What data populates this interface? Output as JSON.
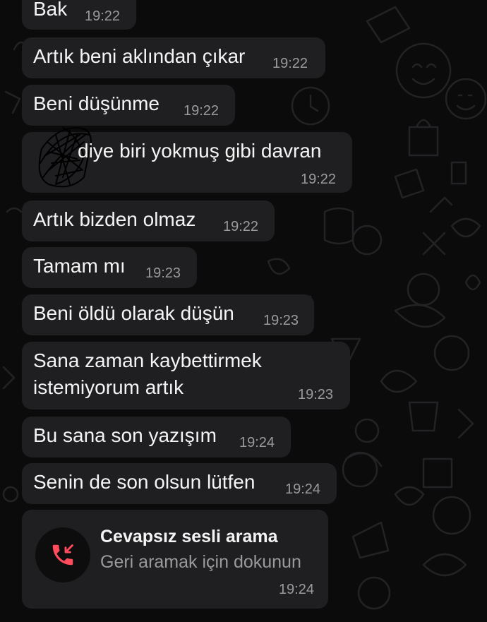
{
  "messages": [
    {
      "text": "Bak",
      "time": "19:22"
    },
    {
      "text": "Artık beni aklından çıkar",
      "time": "19:22"
    },
    {
      "text": "Beni düşünme",
      "time": "19:22"
    },
    {
      "text": "diye biri yokmuş gibi davran",
      "time": "19:22"
    },
    {
      "text": "Artık bizden olmaz",
      "time": "19:22"
    },
    {
      "text": "Tamam mı",
      "time": "19:23"
    },
    {
      "text": "Beni öldü olarak düşün",
      "time": "19:23"
    },
    {
      "text": "Sana zaman kaybettirmek",
      "text2": "istemiyorum artık",
      "time": "19:23"
    },
    {
      "text": "Bu sana son yazışım",
      "time": "19:24"
    },
    {
      "text": "Senin de son olsun lütfen",
      "time": "19:24"
    }
  ],
  "missed_call": {
    "title": "Cevapsız sesli arama",
    "subtitle": "Geri aramak için dokunun",
    "time": "19:24",
    "icon": "missed-call-icon",
    "icon_color": "#ff4b5c"
  },
  "colors": {
    "background": "#0b0b0c",
    "bubble": "#1f1f21",
    "text": "#f4f4f4",
    "timestamp": "#9a9a9d"
  }
}
